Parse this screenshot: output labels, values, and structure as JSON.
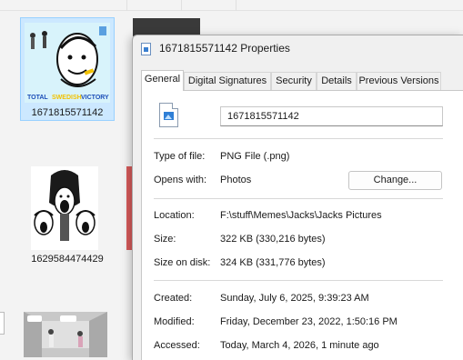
{
  "explorer": {
    "files": [
      {
        "name": "1671815571142",
        "selected": true,
        "thumb_caption": [
          "TOTAL",
          "SWEDISH",
          "VICTORY"
        ]
      },
      {
        "name": "1629584474429",
        "selected": false
      }
    ]
  },
  "dialog": {
    "title": "1671815571142 Properties",
    "tabs": [
      {
        "label": "General",
        "active": true
      },
      {
        "label": "Digital Signatures",
        "active": false
      },
      {
        "label": "Security",
        "active": false
      },
      {
        "label": "Details",
        "active": false
      },
      {
        "label": "Previous Versions",
        "active": false
      }
    ],
    "general": {
      "file_name": "1671815571142",
      "type_label": "Type of file:",
      "type_value": "PNG File (.png)",
      "opens_label": "Opens with:",
      "opens_value": "Photos",
      "change_button": "Change...",
      "location_label": "Location:",
      "location_value": "F:\\stuff\\Memes\\Jacks\\Jacks Pictures",
      "size_label": "Size:",
      "size_value": "322 KB (330,216 bytes)",
      "size_on_disk_label": "Size on disk:",
      "size_on_disk_value": "324 KB (331,776 bytes)",
      "created_label": "Created:",
      "created_value": "Sunday, July 6, 2025, 9:39:23 AM",
      "modified_label": "Modified:",
      "modified_value": "Friday, December 23, 2022, 1:50:16 PM",
      "accessed_label": "Accessed:",
      "accessed_value": "Today, March 4, 2026, 1 minute ago"
    }
  },
  "colors": {
    "selection_fill": "#cce8ff",
    "selection_border": "#99d1ff",
    "caption_total": "#1d4fb8",
    "caption_swedish": "#f2c200",
    "caption_victory": "#1d4fb8"
  }
}
